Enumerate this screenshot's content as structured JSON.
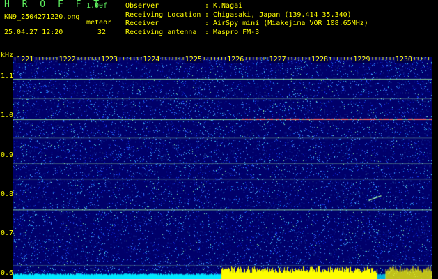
{
  "header": {
    "app_name": "H R O F F T",
    "version": "1.00f",
    "file_name": "KN9_2504271220.png",
    "mode": "meteor",
    "datetime": "25.04.27 12:20",
    "count": "32"
  },
  "station": [
    {
      "label": "Observer",
      "value": "K.Nagai"
    },
    {
      "label": "Receiving Location",
      "value": "Chigasaki, Japan (139.414 35.340)"
    },
    {
      "label": "Receiver",
      "value": "AirSpy mini (Miakejima VOR 108.65MHz)"
    },
    {
      "label": "Receiving antenna",
      "value": "Maspro FM-3"
    }
  ],
  "colors": {
    "background": "#000000",
    "label_text": "#ffff00",
    "title_text": "#5ff05f",
    "waterfall_base": "#00006a",
    "signal_line": "#a8ffa0",
    "strong_signal": "#ff5a5a",
    "level_cyan": "#00e8ff",
    "level_yellow": "#ffff00"
  },
  "chart_data": {
    "type": "heatmap",
    "y_unit": "kHz",
    "x_ticks": [
      "1221",
      "1222",
      "1223",
      "1224",
      "1225",
      "1226",
      "1227",
      "1228",
      "1229",
      "1230"
    ],
    "y_ticks": [
      "1.1",
      "1.0",
      "0.9",
      "0.8",
      "0.7",
      "0.6"
    ],
    "ylim": [
      0.585,
      1.15
    ],
    "xlim": [
      1220.55,
      1230.5
    ],
    "carrier_lines_khz": [
      1.095,
      1.045,
      0.992,
      0.945,
      0.88,
      0.84,
      0.762,
      0.62
    ],
    "strong_carrier_khz": 0.992,
    "strong_carrier_range": [
      1226.0,
      1230.5
    ],
    "meteor_trails": [
      {
        "start_min": 1229.0,
        "end_min": 1229.3,
        "start_khz": 0.785,
        "end_khz": 0.797
      }
    ],
    "level_segments": [
      {
        "start_min": 1220.55,
        "end_min": 1225.5,
        "color": "cyan"
      },
      {
        "start_min": 1225.5,
        "end_min": 1229.2,
        "color": "yellow"
      },
      {
        "start_min": 1229.2,
        "end_min": 1229.4,
        "color": "cyan"
      },
      {
        "start_min": 1229.4,
        "end_min": 1230.5,
        "color": "yellow"
      }
    ]
  }
}
